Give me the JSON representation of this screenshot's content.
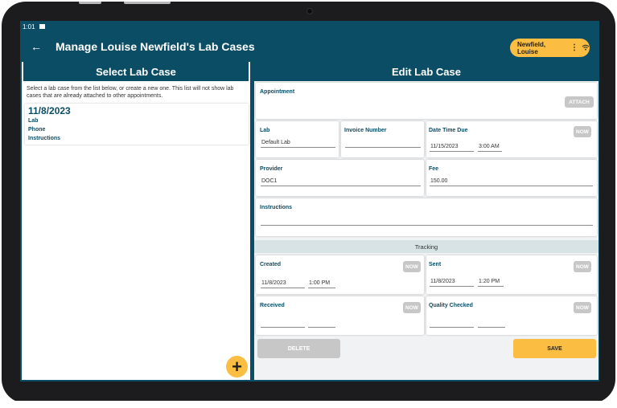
{
  "status": {
    "time": "1:01",
    "image_icon": "image-icon"
  },
  "header": {
    "back_icon": "arrow-left-icon",
    "title": "Manage Louise Newfield's Lab Cases",
    "user_name": "Newfield, Louise",
    "menu_icon": "more-vert-icon",
    "wifi_icon": "wifi-icon"
  },
  "left": {
    "title": "Select Lab Case",
    "intro": "Select a lab case from the list below, or create a new one. This list will not show lab cases that are already attached to other appointments.",
    "cases": [
      {
        "date": "11/8/2023",
        "lab": "Lab",
        "phone": "Phone",
        "instructions": "Instructions"
      }
    ],
    "add_icon": "plus-icon"
  },
  "right": {
    "title": "Edit Lab Case",
    "appointment": {
      "label": "Appointment",
      "attach": "ATTACH"
    },
    "lab": {
      "label": "Lab",
      "value": "Default Lab"
    },
    "invoice": {
      "label": "Invoice Number",
      "value": ""
    },
    "due": {
      "label": "Date Time Due",
      "date": "11/15/2023",
      "time": "3:00 AM",
      "now": "NOW"
    },
    "provider": {
      "label": "Provider",
      "value": "DOC1"
    },
    "fee": {
      "label": "Fee",
      "value": "150.00"
    },
    "instructions": {
      "label": "Instructions",
      "value": ""
    },
    "tracking": "Tracking",
    "created": {
      "label": "Created",
      "date": "11/8/2023",
      "time": "1:00 PM",
      "now": "NOW"
    },
    "sent": {
      "label": "Sent",
      "date": "11/8/2023",
      "time": "1:20 PM",
      "now": "NOW"
    },
    "received": {
      "label": "Received",
      "date": "",
      "time": "",
      "now": "NOW"
    },
    "quality": {
      "label": "Quality Checked",
      "date": "",
      "time": "",
      "now": "NOW"
    },
    "delete": "DELETE",
    "save": "SAVE"
  },
  "colors": {
    "brand": "#0b4d64",
    "accent": "#fbbd42",
    "disabled": "#c7c7c7"
  }
}
